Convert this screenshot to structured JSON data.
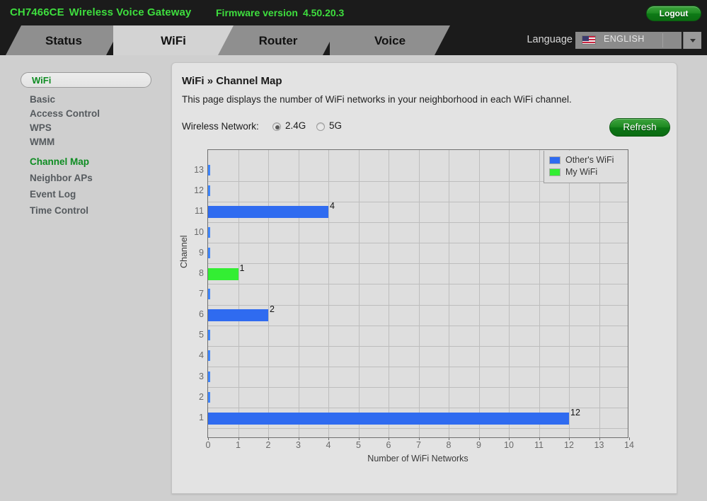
{
  "header": {
    "model": "CH7466CE",
    "product": "Wireless Voice Gateway",
    "firmware_label": "Firmware version",
    "firmware_version": "4.50.20.3",
    "logout_label": "Logout",
    "brand_color": "#3ede3e"
  },
  "language": {
    "label": "Language",
    "selected": "ENGLISH",
    "flag": "us-flag-icon"
  },
  "tabs": [
    {
      "label": "Status",
      "active": false
    },
    {
      "label": "WiFi",
      "active": true
    },
    {
      "label": "Router",
      "active": false
    },
    {
      "label": "Voice",
      "active": false
    }
  ],
  "sidebar": {
    "header": "WiFi",
    "items": [
      {
        "label": "Basic",
        "selected": false
      },
      {
        "label": "Access Control",
        "selected": false
      },
      {
        "label": "WPS",
        "selected": false
      },
      {
        "label": "WMM",
        "selected": false
      },
      {
        "label": "Channel Map",
        "selected": true
      },
      {
        "label": "Neighbor APs",
        "selected": false
      },
      {
        "label": "Event Log",
        "selected": false
      },
      {
        "label": "Time Control",
        "selected": false
      }
    ]
  },
  "main": {
    "breadcrumb": "WiFi » Channel Map",
    "description": "This page displays the number of WiFi networks in your neighborhood in each WiFi channel.",
    "wireless_network_label": "Wireless Network:",
    "radio_options": [
      {
        "label": "2.4G",
        "selected": true
      },
      {
        "label": "5G",
        "selected": false
      }
    ],
    "refresh_label": "Refresh"
  },
  "chart_data": {
    "type": "bar",
    "orientation": "horizontal",
    "title": "",
    "xlabel": "Number of WiFi Networks",
    "ylabel": "Channel",
    "xlim": [
      0,
      14
    ],
    "xticks": [
      0,
      1,
      2,
      3,
      4,
      5,
      6,
      7,
      8,
      9,
      10,
      11,
      12,
      13,
      14
    ],
    "categories": [
      1,
      2,
      3,
      4,
      5,
      6,
      7,
      8,
      9,
      10,
      11,
      12,
      13
    ],
    "grid": true,
    "legend_position": "top-right",
    "legend": [
      {
        "name": "Other's WiFi",
        "color": "#2f6bf0"
      },
      {
        "name": "My WiFi",
        "color": "#33ee33"
      }
    ],
    "bars": [
      {
        "channel": 1,
        "value": 12,
        "series": "Other's WiFi",
        "label": "12"
      },
      {
        "channel": 2,
        "value": 0,
        "series": "Other's WiFi",
        "label": ""
      },
      {
        "channel": 3,
        "value": 0,
        "series": "Other's WiFi",
        "label": ""
      },
      {
        "channel": 4,
        "value": 0,
        "series": "Other's WiFi",
        "label": ""
      },
      {
        "channel": 5,
        "value": 0,
        "series": "Other's WiFi",
        "label": ""
      },
      {
        "channel": 6,
        "value": 2,
        "series": "Other's WiFi",
        "label": "2"
      },
      {
        "channel": 7,
        "value": 0,
        "series": "Other's WiFi",
        "label": ""
      },
      {
        "channel": 8,
        "value": 1,
        "series": "My WiFi",
        "label": "1"
      },
      {
        "channel": 9,
        "value": 0,
        "series": "Other's WiFi",
        "label": ""
      },
      {
        "channel": 10,
        "value": 0,
        "series": "Other's WiFi",
        "label": ""
      },
      {
        "channel": 11,
        "value": 4,
        "series": "Other's WiFi",
        "label": "4"
      },
      {
        "channel": 12,
        "value": 0,
        "series": "Other's WiFi",
        "label": ""
      },
      {
        "channel": 13,
        "value": 0,
        "series": "Other's WiFi",
        "label": ""
      }
    ]
  }
}
